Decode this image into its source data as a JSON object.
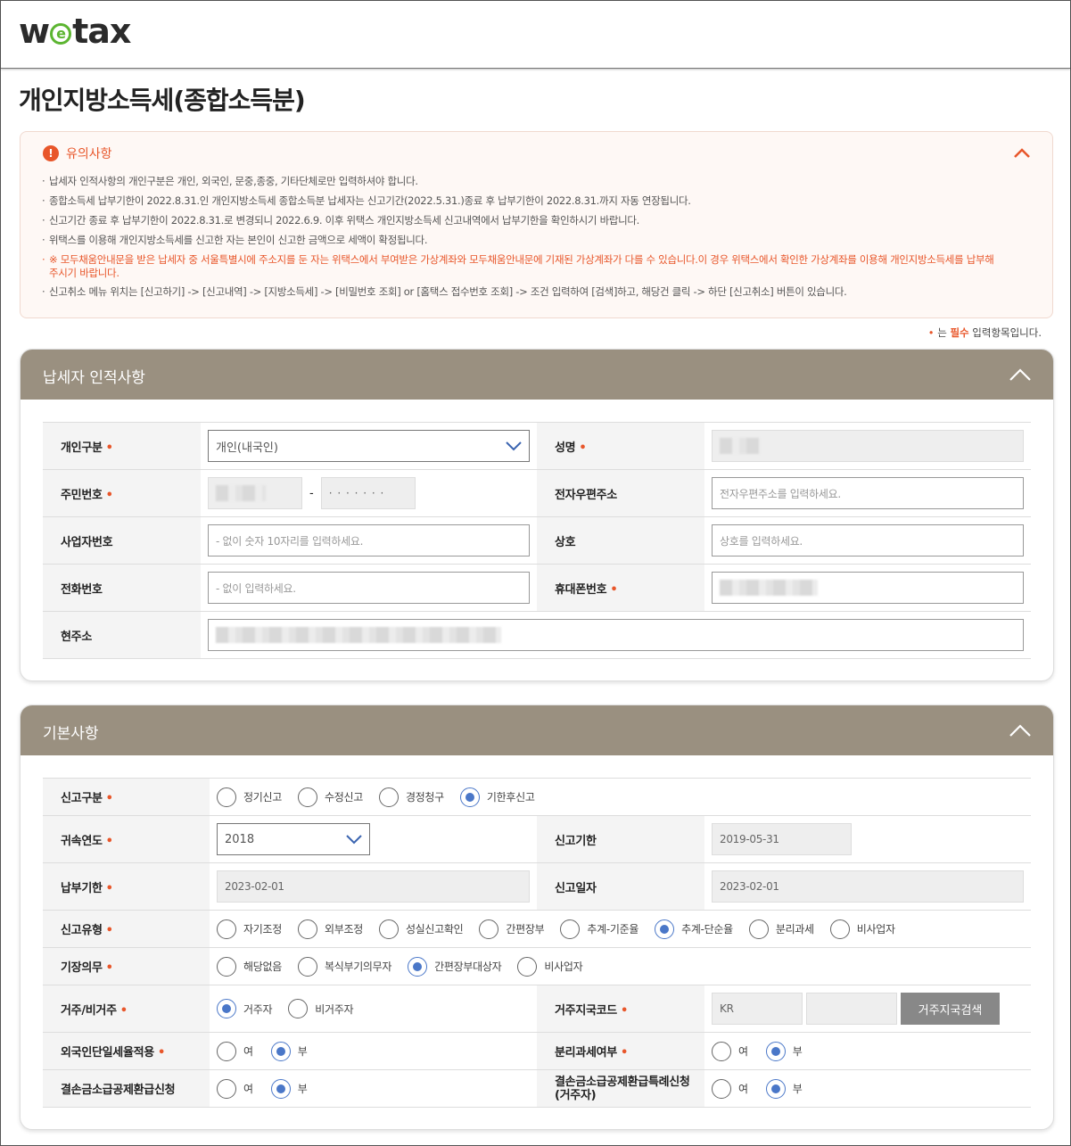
{
  "header": {
    "logo_pre": "w",
    "logo_e": "e",
    "logo_post": "tax"
  },
  "page_title": "개인지방소득세(종합소득분)",
  "notice": {
    "title": "유의사항",
    "items": [
      "납세자 인적사항의 개인구분은 개인, 외국인, 문중,종중, 기타단체로만 입력하셔야 합니다.",
      "종합소득세 납부기한이 2022.8.31.인 개인지방소득세 종합소득분 납세자는 신고기간(2022.5.31.)종료 후 납부기한이 2022.8.31.까지 자동 연장됩니다.",
      "신고기간 종료 후 납부기한이 2022.8.31.로 변경되니 2022.6.9. 이후 위택스 개인지방소득세 신고내역에서 납부기한을 확인하시기 바랍니다.",
      "위택스를 이용해 개인지방소득세를 신고한 자는 본인이 신고한 금액으로 세액이 확정됩니다.",
      "※ 모두채움안내문을 받은 납세자 중 서울특별시에 주소지를 둔 자는 위택스에서 부여받은 가상계좌와 모두채움안내문에 기재된 가상계좌가 다를 수 있습니다.이 경우 위택스에서 확인한 가상계좌를 이용해 개인지방소득세를 납부해 주시기 바랍니다.",
      "신고취소 메뉴 위치는 [신고하기] -> [신고내역] -> [지방소득세] -> [비밀번호 조회] or [홈택스 접수번호 조회] -> 조건 입력하여 [검색]하고, 해당건 클릭 -> 하단 [신고취소] 버튼이 있습니다."
    ]
  },
  "required_note": {
    "dot": "•",
    "pre": " 는 ",
    "bold": "필수",
    "post": " 입력항목입니다."
  },
  "taxpayer": {
    "title": "납세자 인적사항",
    "type_label": "개인구분",
    "type_value": "개인(내국인)",
    "name_label": "성명",
    "rrn_label": "주민번호",
    "rrn_sep": "-",
    "rrn_back": "· · · · · · ·",
    "email_label": "전자우편주소",
    "email_placeholder": "전자우편주소를 입력하세요.",
    "bizno_label": "사업자번호",
    "bizno_placeholder": "- 없이 숫자 10자리를 입력하세요.",
    "trade_label": "상호",
    "trade_placeholder": "상호를 입력하세요.",
    "phone_label": "전화번호",
    "phone_placeholder": "- 없이 입력하세요.",
    "mobile_label": "휴대폰번호",
    "address_label": "현주소"
  },
  "basic": {
    "title": "기본사항",
    "report_type_label": "신고구분",
    "report_types": [
      "정기신고",
      "수정신고",
      "경정청구",
      "기한후신고"
    ],
    "report_type_selected": 3,
    "year_label": "귀속연도",
    "year_value": "2018",
    "deadline_label": "신고기한",
    "deadline_value": "2019-05-31",
    "pay_deadline_label": "납부기한",
    "pay_deadline_value": "2023-02-01",
    "report_date_label": "신고일자",
    "report_date_value": "2023-02-01",
    "filing_type_label": "신고유형",
    "filing_types": [
      "자기조정",
      "외부조정",
      "성실신고확인",
      "간편장부",
      "추계-기준율",
      "추계-단순율",
      "분리과세",
      "비사업자"
    ],
    "filing_type_selected": 5,
    "bookkeeping_label": "기장의무",
    "bookkeeping": [
      "해당없음",
      "복식부기의무자",
      "간편장부대상자",
      "비사업자"
    ],
    "bookkeeping_selected": 2,
    "residency_label": "거주/비거주",
    "residency": [
      "거주자",
      "비거주자"
    ],
    "residency_selected": 0,
    "residence_code_label": "거주지국코드",
    "residence_code_value": "KR",
    "residence_search_btn": "거주지국검색",
    "foreign_flat_label": "외국인단일세율적용",
    "separate_tax_label": "분리과세여부",
    "loss_refund_label": "결손금소급공제환급신청",
    "loss_refund_special_label": "결손금소급공제환급특례신청\n(거주자)",
    "yes": "여",
    "no": "부"
  },
  "colors": {
    "accent": "#e8562a",
    "section_header": "#9a9080",
    "radio_on": "#4a77c8"
  }
}
